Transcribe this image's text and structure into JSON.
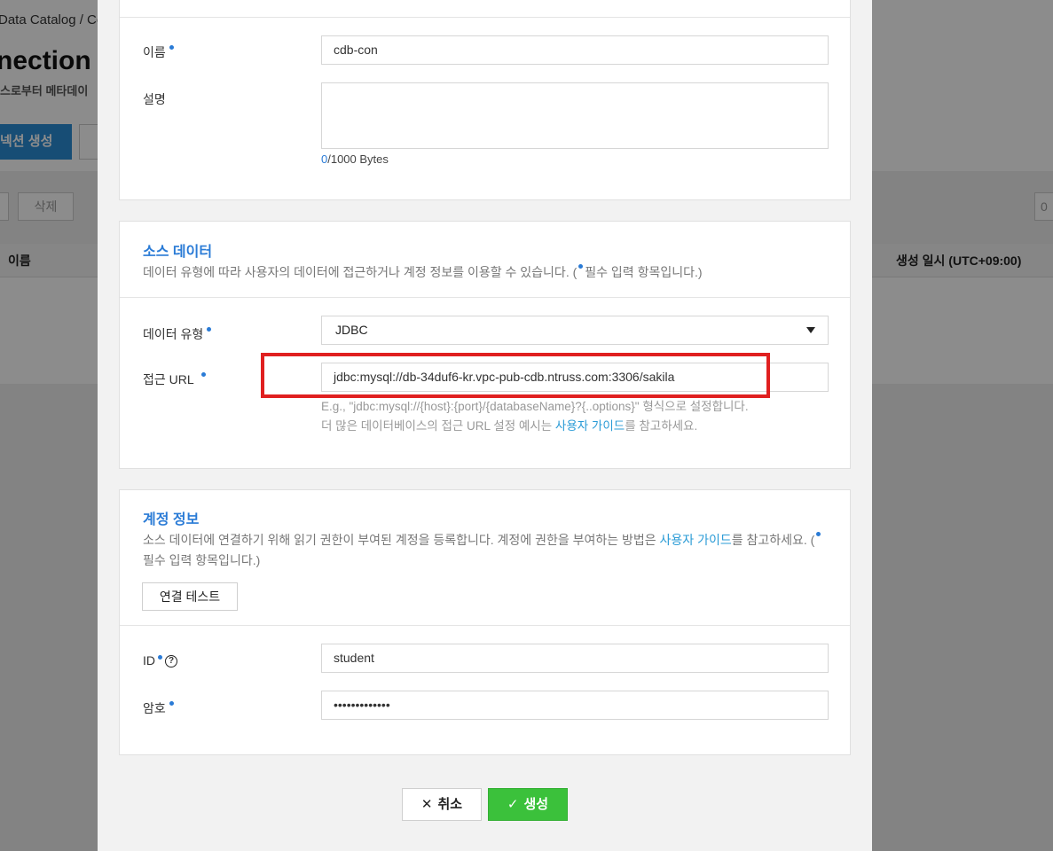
{
  "background": {
    "breadcrumb": "Data Catalog /  Co",
    "title": "nection",
    "subtitle": "스로부터 메타데이",
    "create_button": "넥션 생성",
    "delete_button": "삭제",
    "col_name": "이름",
    "col_created": "생성 일시 (UTC+09:00)",
    "right_small": "0"
  },
  "basic": {
    "name_label": "이름",
    "name_value": "cdb-con",
    "desc_label": "설명",
    "desc_value": "",
    "bytes_count": "0",
    "bytes_suffix": "/1000 Bytes"
  },
  "source": {
    "title": "소스 데이터",
    "desc_prefix": "데이터 유형에 따라 사용자의 데이터에 접근하거나 계정 정보를 이용할 수 있습니다. (",
    "desc_suffix": "필수 입력 항목입니다.)",
    "type_label": "데이터 유형",
    "type_value": "JDBC",
    "url_label": "접근 URL",
    "url_value": "jdbc:mysql://db-34duf6-kr.vpc-pub-cdb.ntruss.com:3306/sakila",
    "helper_line1": "E.g., \"jdbc:mysql://{host}:{port}/{databaseName}?{..options}\" 형식으로 설정합니다.",
    "helper_line2_prefix": "더 많은 데이터베이스의 접근 URL 설정 예시는 ",
    "helper_link": "사용자 가이드",
    "helper_line2_suffix": "를 참고하세요."
  },
  "account": {
    "title": "계정 정보",
    "desc_prefix": "소스 데이터에 연결하기 위해 읽기 권한이 부여된 계정을 등록합니다. 계정에 권한을 부여하는 방법은 ",
    "desc_link": "사용자 가이드",
    "desc_mid": "를 참고하세요. (",
    "desc_line2": "필수 입력 항목입니다.)",
    "test_button": "연결 테스트",
    "id_label": "ID",
    "id_value": "student",
    "pw_label": "암호",
    "pw_value": "•••••••••••••"
  },
  "footer": {
    "cancel_label": "취소",
    "create_label": "생성"
  },
  "colors": {
    "accent": "#2a7bd6",
    "link": "#2a9bd6",
    "create": "#3bc13b",
    "highlight": "#e02020"
  }
}
